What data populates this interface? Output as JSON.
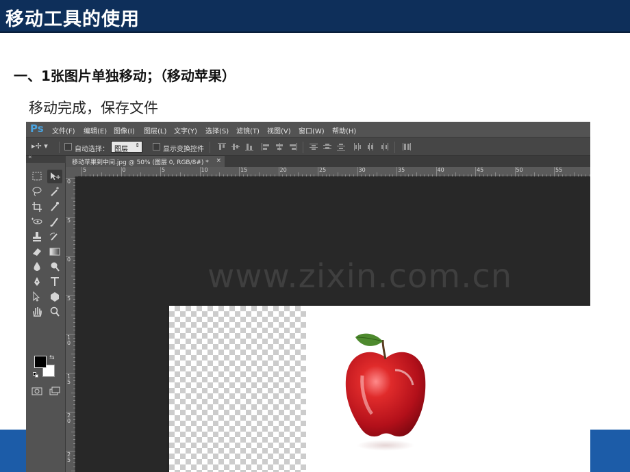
{
  "slide": {
    "title": "移动工具的使用",
    "section_heading": "一、1张图片单独移动；（移动苹果）",
    "subtext": "移动完成，保存文件"
  },
  "photoshop": {
    "logo": "Ps",
    "menu": [
      "文件(F)",
      "编辑(E)",
      "图像(I)",
      "图层(L)",
      "文字(Y)",
      "选择(S)",
      "滤镜(T)",
      "视图(V)",
      "窗口(W)",
      "帮助(H)"
    ],
    "options": {
      "auto_select_label": "自动选择：",
      "auto_select_value": "图层",
      "show_transform_label": "显示变换控件"
    },
    "document_tab": "移动苹果到中间.jpg @ 50% (图层 0, RGB/8#) *",
    "tab_close": "×",
    "ruler_h_labels": [
      "5",
      "0",
      "5",
      "10",
      "15",
      "20",
      "25",
      "30",
      "35",
      "40",
      "45",
      "50",
      "55"
    ],
    "ruler_v_labels": [
      "0",
      "5",
      "0",
      "5",
      "1 0",
      "1 5",
      "2 0",
      "2 5"
    ],
    "watermark": "www.zixin.com.cn"
  },
  "colors": {
    "title_bar": "#0e2f5a",
    "bottom_band": "#1c5ca8",
    "ps_menubar": "#535353",
    "ps_workspace": "#282828",
    "ps_logo": "#4aa3df"
  }
}
